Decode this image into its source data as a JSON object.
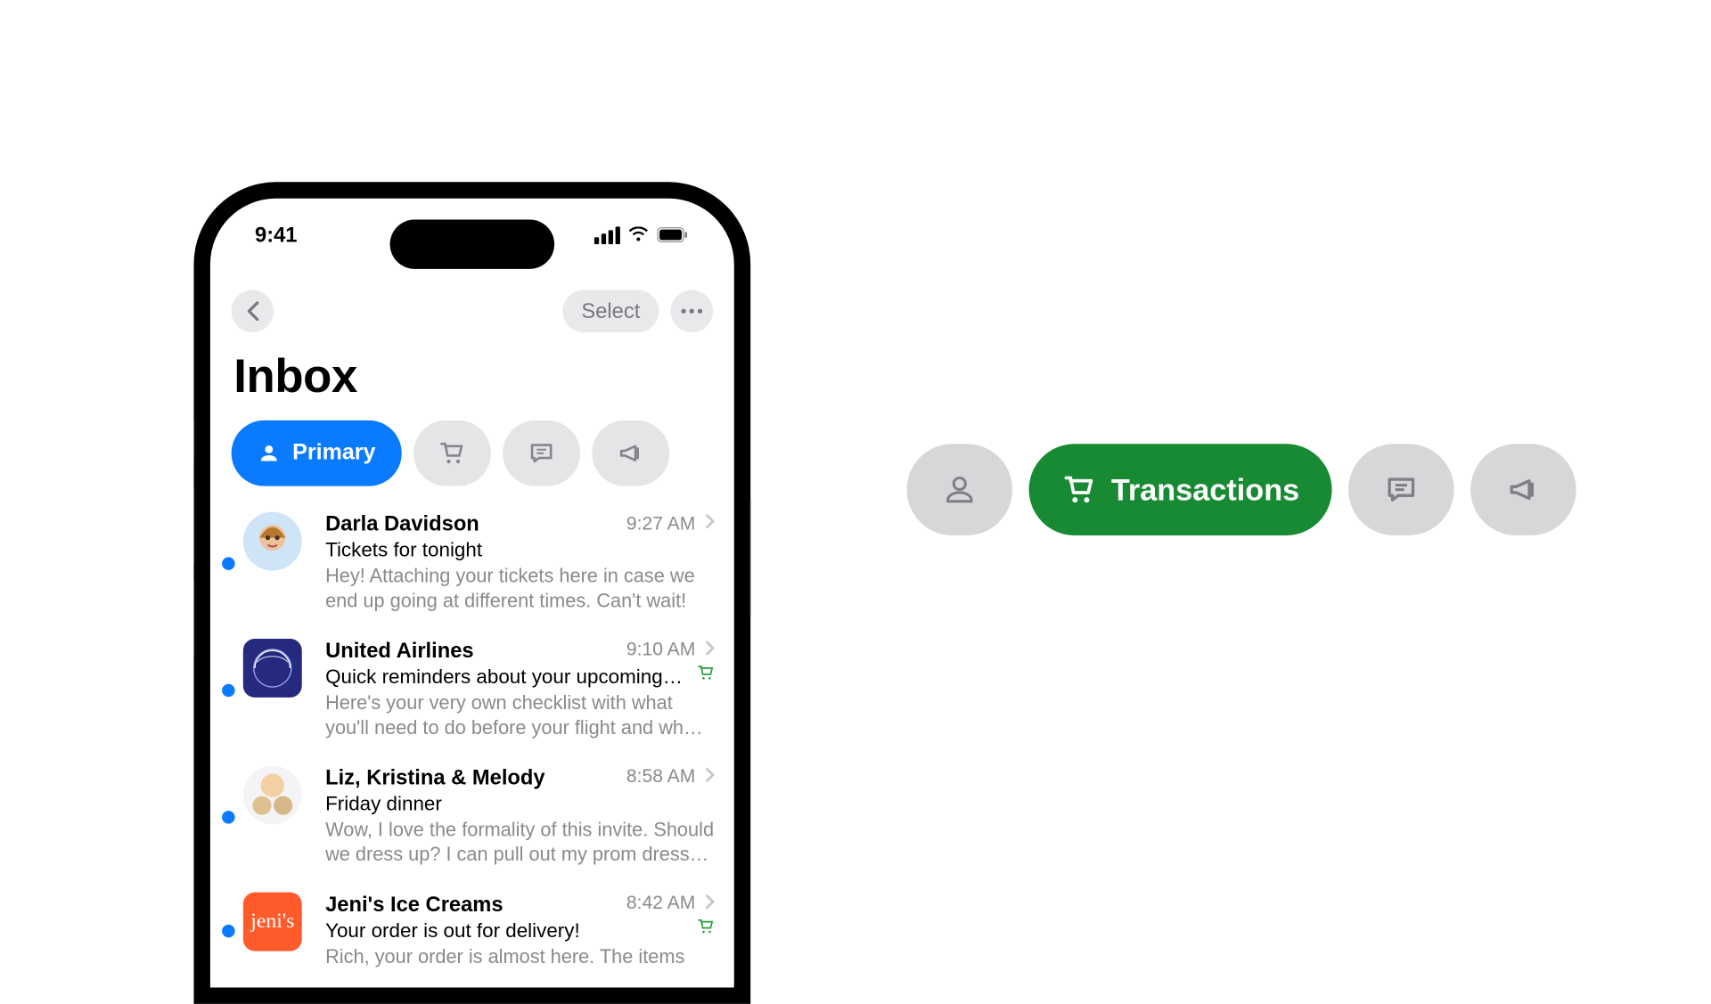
{
  "status": {
    "time": "9:41"
  },
  "toolbar": {
    "select_label": "Select"
  },
  "page": {
    "title": "Inbox"
  },
  "categories": {
    "primary_label": "Primary"
  },
  "emails": [
    {
      "sender": "Darla Davidson",
      "time": "9:27 AM",
      "subject": "Tickets for tonight",
      "preview": "Hey! Attaching your tickets here in case we end up going at different times. Can't wait!",
      "avatar_type": "face",
      "unread": true,
      "has_cart_tag": false
    },
    {
      "sender": "United Airlines",
      "time": "9:10 AM",
      "subject": "Quick reminders about your upcoming…",
      "preview": "Here's your very own checklist with what you'll need to do before your flight and wh…",
      "avatar_type": "blue-square",
      "avatar_text": "✈",
      "unread": true,
      "has_cart_tag": true
    },
    {
      "sender": "Liz, Kristina & Melody",
      "time": "8:58 AM",
      "subject": "Friday dinner",
      "preview": "Wow, I love the formality of this invite. Should we dress up? I can pull out my prom dress…",
      "avatar_type": "group",
      "unread": true,
      "has_cart_tag": false
    },
    {
      "sender": "Jeni's Ice Creams",
      "time": "8:42 AM",
      "subject": "Your order is out for delivery!",
      "preview": "Rich, your order is almost here. The items",
      "avatar_type": "orange-square",
      "avatar_text": "jeni's",
      "unread": true,
      "has_cart_tag": true
    }
  ],
  "right_pills": {
    "transactions_label": "Transactions"
  }
}
